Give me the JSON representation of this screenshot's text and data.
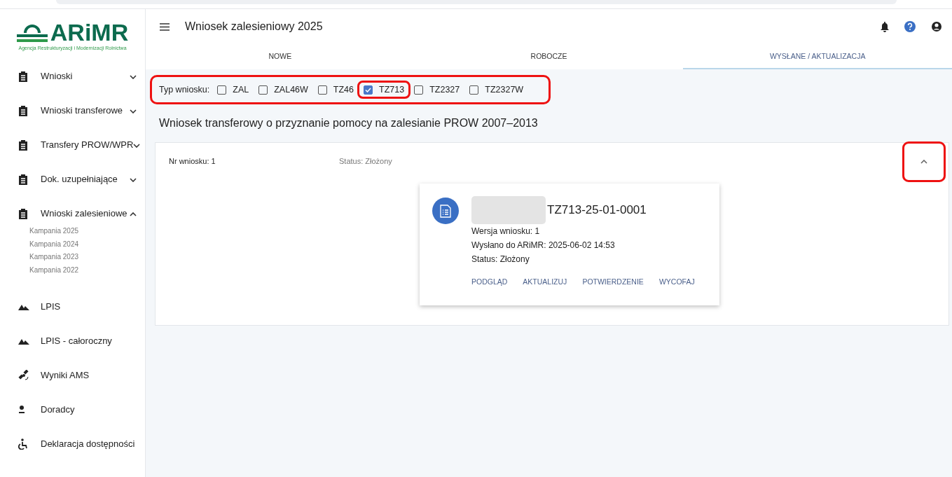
{
  "logo": {
    "name": "ARiMR",
    "subtitle": "Agencja Restrukturyzacji i Modernizacji Rolnictwa"
  },
  "sidebar": {
    "items": [
      {
        "label": "Wnioski",
        "expanded": false
      },
      {
        "label": "Wnioski transferowe",
        "expanded": false
      },
      {
        "label": "Transfery PROW/WPR",
        "expanded": false
      },
      {
        "label": "Dok. uzupełniające",
        "expanded": false
      },
      {
        "label": "Wnioski zalesieniowe",
        "expanded": true,
        "children": [
          {
            "label": "Kampania 2025"
          },
          {
            "label": "Kampania 2024"
          },
          {
            "label": "Kampania 2023"
          },
          {
            "label": "Kampania 2022"
          }
        ]
      },
      {
        "label": "LPIS"
      },
      {
        "label": "LPIS - całoroczny"
      },
      {
        "label": "Wyniki AMS"
      },
      {
        "label": "Doradcy"
      },
      {
        "label": "Deklaracja dostępności"
      }
    ]
  },
  "header": {
    "title": "Wniosek zalesieniowy 2025"
  },
  "tabs": [
    {
      "label": "NOWE",
      "selected": false
    },
    {
      "label": "ROBOCZE",
      "selected": false
    },
    {
      "label": "WYSŁANE / AKTUALIZACJA",
      "selected": true
    }
  ],
  "filter": {
    "label": "Typ wniosku:",
    "highlighted": true,
    "options": [
      {
        "label": "ZAL",
        "checked": false,
        "highlighted": false
      },
      {
        "label": "ZAL46W",
        "checked": false,
        "highlighted": false
      },
      {
        "label": "TZ46",
        "checked": false,
        "highlighted": false
      },
      {
        "label": "TZ713",
        "checked": true,
        "highlighted": true
      },
      {
        "label": "TZ2327",
        "checked": false,
        "highlighted": false
      },
      {
        "label": "TZ2327W",
        "checked": false,
        "highlighted": false
      }
    ]
  },
  "section_title": "Wniosek transferowy o przyznanie pomocy na zalesianie PROW 2007–2013",
  "panel": {
    "number": "Nr wniosku: 1",
    "status": "Status: Złożony",
    "expanded": true,
    "toggle_highlighted": true,
    "card": {
      "redacted": true,
      "title": "TZ713-25-01-0001",
      "lines": [
        "Wersja wniosku: 1",
        "Wysłano do ARiMR: 2025-06-02 14:53",
        "Status: Złożony"
      ],
      "actions": [
        "PODGLĄD",
        "AKTUALIZUJ",
        "POTWIERDZENIE",
        "WYCOFAJ"
      ]
    }
  }
}
